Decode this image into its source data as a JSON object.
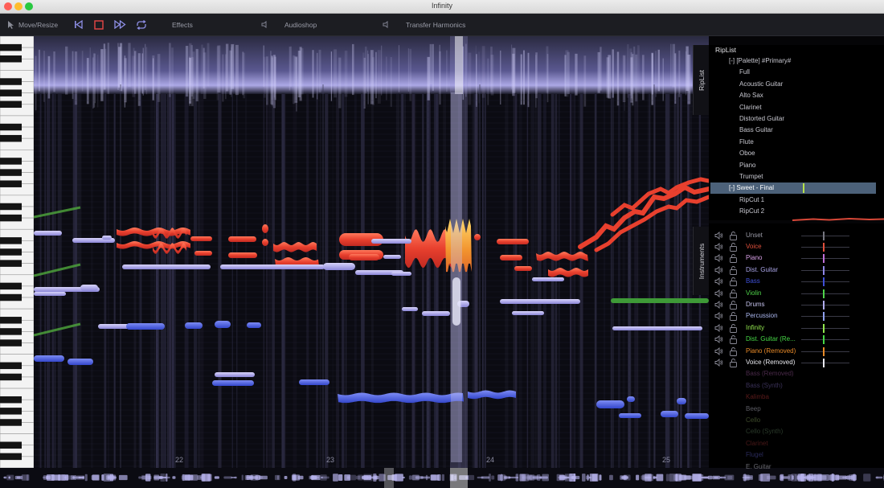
{
  "window": {
    "title": "Infinity"
  },
  "colors": {
    "accent_red": "#e8503a",
    "accent_blue": "#5b6ad8",
    "accent_lavender": "#a9a4e6",
    "accent_green": "#57c94c",
    "selection": "#4c6179"
  },
  "toolbar": {
    "move_resize_label": "Move/Resize",
    "effects_label": "Effects",
    "audioshop_label": "Audioshop",
    "transfer_harmonics_label": "Transfer Harmonics",
    "icons": [
      "cursor-icon",
      "skip-back-icon",
      "stop-icon",
      "fast-forward-icon",
      "loop-icon",
      "speaker-icon"
    ]
  },
  "timeline": {
    "bars": [
      "22",
      "23",
      "24",
      "25"
    ]
  },
  "side_tabs": {
    "riplist": "RipList",
    "instruments": "Instruments"
  },
  "riplist": {
    "header": "RipList",
    "items": [
      {
        "label": "[-] [Palette] #Primary#",
        "indent": 1
      },
      {
        "label": "Full",
        "indent": 2
      },
      {
        "label": "Acoustic Guitar",
        "indent": 2
      },
      {
        "label": "Alto Sax",
        "indent": 2
      },
      {
        "label": "Clarinet",
        "indent": 2
      },
      {
        "label": "Distorted Guitar",
        "indent": 2
      },
      {
        "label": "Bass Guitar",
        "indent": 2
      },
      {
        "label": "Flute",
        "indent": 2
      },
      {
        "label": "Oboe",
        "indent": 2
      },
      {
        "label": "Piano",
        "indent": 2
      },
      {
        "label": "Trumpet",
        "indent": 2
      },
      {
        "label": "[-] Sweet - Final",
        "indent": 1,
        "selected": true
      },
      {
        "label": "RipCut 1",
        "indent": 2
      },
      {
        "label": "RipCut 2",
        "indent": 2
      }
    ]
  },
  "instruments": [
    {
      "label": "Unset",
      "color": "#9a9aa6",
      "controls": true,
      "meter": "#777780"
    },
    {
      "label": "Voice",
      "color": "#e0503c",
      "controls": true,
      "meter": "#e0503c"
    },
    {
      "label": "Piano",
      "color": "#d8a0e6",
      "controls": true,
      "meter": "#c070d8"
    },
    {
      "label": "Dist. Guitar",
      "color": "#a9a4e6",
      "controls": true,
      "meter": "#8f87e6"
    },
    {
      "label": "Bass",
      "color": "#3e4fd6",
      "controls": true,
      "meter": "#3e4fd6"
    },
    {
      "label": "Violin",
      "color": "#4fd44a",
      "controls": true,
      "meter": "#4fd44a"
    },
    {
      "label": "Drums",
      "color": "#c6c3ee",
      "controls": true,
      "meter": "#b0acee"
    },
    {
      "label": "Percussion",
      "color": "#aab6ee",
      "controls": true,
      "meter": "#8fa0ee"
    },
    {
      "label": "Infinity",
      "color": "#93e64f",
      "controls": true,
      "meter": "#93e64f"
    },
    {
      "label": "Dist. Guitar (Re...",
      "color": "#46d846",
      "controls": true,
      "meter": "#46d846"
    },
    {
      "label": "Piano (Removed)",
      "color": "#e88a28",
      "controls": true,
      "meter": "#e88a28"
    },
    {
      "label": "Voice (Removed)",
      "color": "#e8e8ee",
      "controls": true,
      "meter": "#e8e8ee"
    },
    {
      "label": "Bass (Removed)",
      "color": "#4a2a4a",
      "controls": false
    },
    {
      "label": "Bass (Synth)",
      "color": "#3a3158",
      "controls": false
    },
    {
      "label": "Kalimba",
      "color": "#5a1a1a",
      "controls": false
    },
    {
      "label": "Beep",
      "color": "#5c5c64",
      "controls": false
    },
    {
      "label": "Cello",
      "color": "#3d4a2a",
      "controls": false
    },
    {
      "label": "Cello (Synth)",
      "color": "#2a3a2a",
      "controls": false
    },
    {
      "label": "Clarinet",
      "color": "#4a1818",
      "controls": false
    },
    {
      "label": "Flugel",
      "color": "#2a2a5a",
      "controls": false
    },
    {
      "label": "E. Guitar",
      "color": "#6a6a72",
      "controls": false
    }
  ]
}
